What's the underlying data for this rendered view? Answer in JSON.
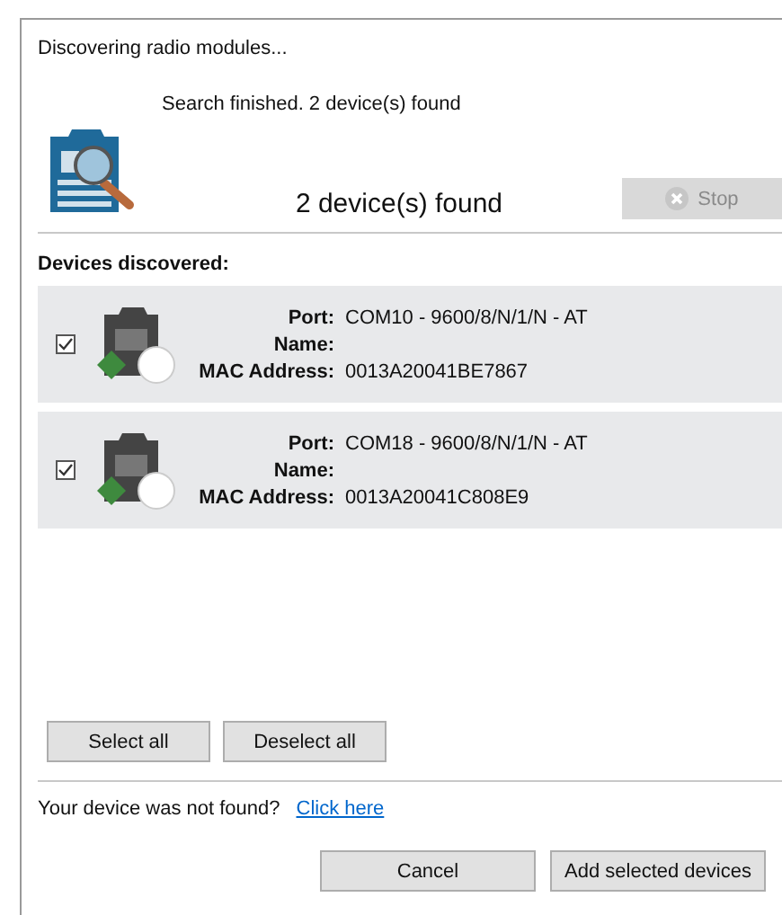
{
  "window": {
    "title": "Discovering radio modules..."
  },
  "status": "Search finished. 2 device(s) found",
  "summary": "2 device(s) found",
  "stop_button": {
    "label": "Stop",
    "disabled": true
  },
  "devices_heading": "Devices discovered:",
  "devices": [
    {
      "checked": true,
      "fields": [
        {
          "label": "Port:",
          "value": "COM10 - 9600/8/N/1/N - AT"
        },
        {
          "label": "Name:"
        },
        {
          "label": "MAC Address:",
          "value": "0013A20041BE7867"
        }
      ]
    },
    {
      "checked": true,
      "fields": [
        {
          "label": "Port:",
          "value": "COM18 - 9600/8/N/1/N - AT"
        },
        {
          "label": "Name:"
        },
        {
          "label": "MAC Address:",
          "value": "0013A20041C808E9"
        }
      ]
    }
  ],
  "selection_buttons": [
    "Select all",
    "Deselect all"
  ],
  "not_found": {
    "text": "Your device was not found?",
    "link": "Click here"
  },
  "dialog_buttons": [
    "Cancel",
    "Add selected devices"
  ]
}
